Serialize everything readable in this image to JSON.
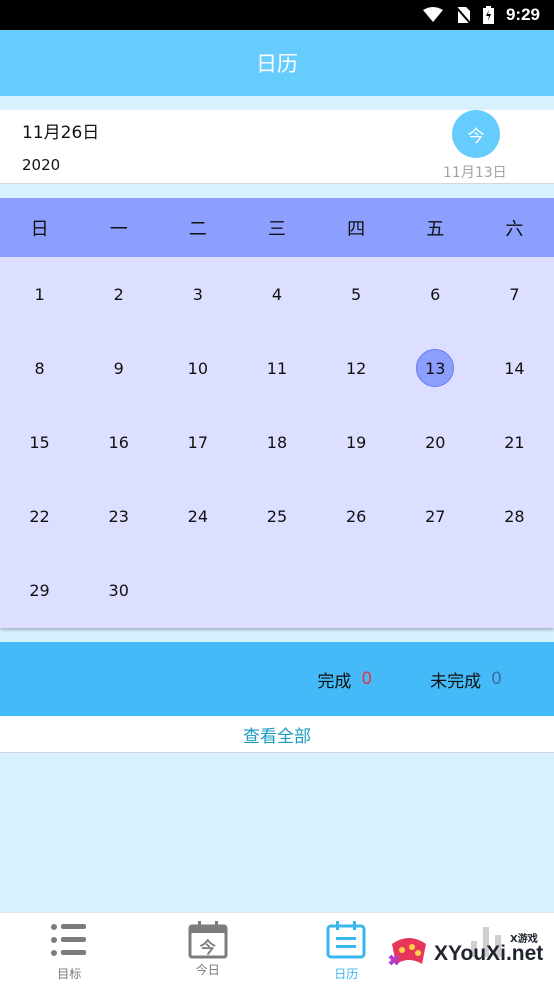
{
  "status_bar": {
    "time": "9:29"
  },
  "app_bar": {
    "title": "日历"
  },
  "date_card": {
    "current_date": "11月26日",
    "current_year": "2020",
    "today_button": "今",
    "today_date": "11月13日"
  },
  "calendar": {
    "weekdays": [
      "日",
      "一",
      "二",
      "三",
      "四",
      "五",
      "六"
    ],
    "days": [
      "1",
      "2",
      "3",
      "4",
      "5",
      "6",
      "7",
      "8",
      "9",
      "10",
      "11",
      "12",
      "13",
      "14",
      "15",
      "16",
      "17",
      "18",
      "19",
      "20",
      "21",
      "22",
      "23",
      "24",
      "25",
      "26",
      "27",
      "28",
      "29",
      "30"
    ],
    "selected_day": "13"
  },
  "stats": {
    "done_label": "完成",
    "done_count": "0",
    "undone_label": "未完成",
    "undone_count": "0"
  },
  "view_all": "查看全部",
  "bottom_nav": {
    "items": [
      {
        "label": "目标",
        "icon": "list-icon"
      },
      {
        "label": "今日",
        "icon": "calendar-today-icon",
        "icon_text": "今"
      },
      {
        "label": "日历",
        "icon": "calendar-icon"
      },
      {
        "label": "",
        "icon": "chart-icon"
      }
    ],
    "active_index": 2
  },
  "watermark": {
    "text": "XYouXi.net",
    "small": "X游戏"
  },
  "colors": {
    "app_bar": "#66ccfd",
    "weekday_row": "#8c9ffe",
    "calendar_bg": "#dcdfff",
    "stats_bar": "#44bbf8",
    "page_bg": "#d8f1fe",
    "active_nav": "#38b6ee"
  }
}
